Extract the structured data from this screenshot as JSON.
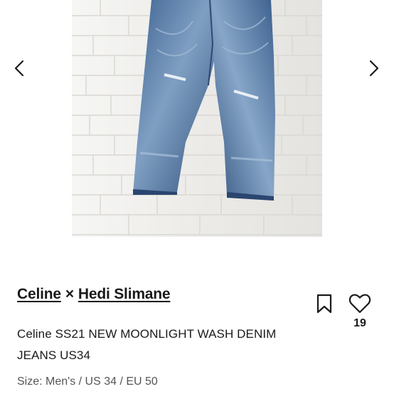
{
  "listing": {
    "designers": [
      "Celine",
      "Hedi Slimane"
    ],
    "designer_separator": "×",
    "title": "Celine SS21 NEW MOONLIGHT WASH DENIM JEANS US34",
    "size": "Size: Men's / US 34 / EU 50",
    "like_count": "19"
  },
  "gallery": {
    "image_subject": "faded blue denim jeans hanging on white brick wall",
    "prev_icon": "chevron-left-icon",
    "next_icon": "chevron-right-icon"
  },
  "actions": {
    "save_icon": "bookmark-icon",
    "like_icon": "heart-icon"
  },
  "colors": {
    "text": "#1a1a1a",
    "muted": "#555555",
    "denim": "#4a6f9a",
    "brick": "#ecebe8"
  }
}
